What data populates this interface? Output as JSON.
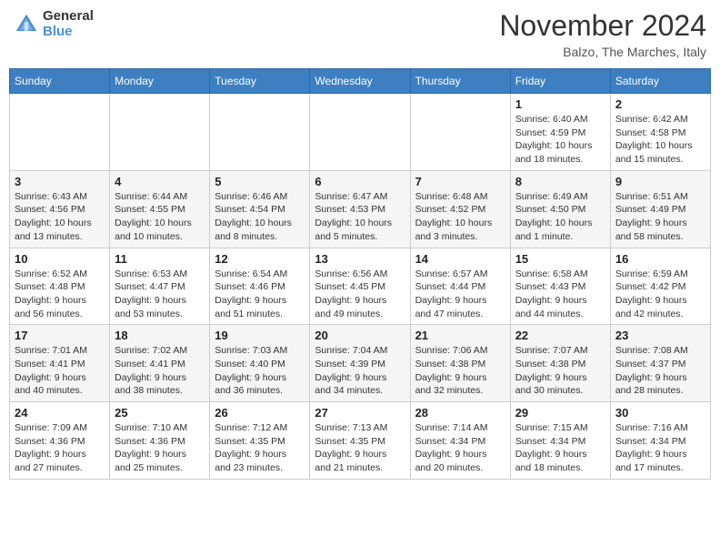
{
  "header": {
    "logo_general": "General",
    "logo_blue": "Blue",
    "month_title": "November 2024",
    "location": "Balzo, The Marches, Italy"
  },
  "weekdays": [
    "Sunday",
    "Monday",
    "Tuesday",
    "Wednesday",
    "Thursday",
    "Friday",
    "Saturday"
  ],
  "weeks": [
    [
      {
        "day": "",
        "info": ""
      },
      {
        "day": "",
        "info": ""
      },
      {
        "day": "",
        "info": ""
      },
      {
        "day": "",
        "info": ""
      },
      {
        "day": "",
        "info": ""
      },
      {
        "day": "1",
        "info": "Sunrise: 6:40 AM\nSunset: 4:59 PM\nDaylight: 10 hours\nand 18 minutes."
      },
      {
        "day": "2",
        "info": "Sunrise: 6:42 AM\nSunset: 4:58 PM\nDaylight: 10 hours\nand 15 minutes."
      }
    ],
    [
      {
        "day": "3",
        "info": "Sunrise: 6:43 AM\nSunset: 4:56 PM\nDaylight: 10 hours\nand 13 minutes."
      },
      {
        "day": "4",
        "info": "Sunrise: 6:44 AM\nSunset: 4:55 PM\nDaylight: 10 hours\nand 10 minutes."
      },
      {
        "day": "5",
        "info": "Sunrise: 6:46 AM\nSunset: 4:54 PM\nDaylight: 10 hours\nand 8 minutes."
      },
      {
        "day": "6",
        "info": "Sunrise: 6:47 AM\nSunset: 4:53 PM\nDaylight: 10 hours\nand 5 minutes."
      },
      {
        "day": "7",
        "info": "Sunrise: 6:48 AM\nSunset: 4:52 PM\nDaylight: 10 hours\nand 3 minutes."
      },
      {
        "day": "8",
        "info": "Sunrise: 6:49 AM\nSunset: 4:50 PM\nDaylight: 10 hours\nand 1 minute."
      },
      {
        "day": "9",
        "info": "Sunrise: 6:51 AM\nSunset: 4:49 PM\nDaylight: 9 hours\nand 58 minutes."
      }
    ],
    [
      {
        "day": "10",
        "info": "Sunrise: 6:52 AM\nSunset: 4:48 PM\nDaylight: 9 hours\nand 56 minutes."
      },
      {
        "day": "11",
        "info": "Sunrise: 6:53 AM\nSunset: 4:47 PM\nDaylight: 9 hours\nand 53 minutes."
      },
      {
        "day": "12",
        "info": "Sunrise: 6:54 AM\nSunset: 4:46 PM\nDaylight: 9 hours\nand 51 minutes."
      },
      {
        "day": "13",
        "info": "Sunrise: 6:56 AM\nSunset: 4:45 PM\nDaylight: 9 hours\nand 49 minutes."
      },
      {
        "day": "14",
        "info": "Sunrise: 6:57 AM\nSunset: 4:44 PM\nDaylight: 9 hours\nand 47 minutes."
      },
      {
        "day": "15",
        "info": "Sunrise: 6:58 AM\nSunset: 4:43 PM\nDaylight: 9 hours\nand 44 minutes."
      },
      {
        "day": "16",
        "info": "Sunrise: 6:59 AM\nSunset: 4:42 PM\nDaylight: 9 hours\nand 42 minutes."
      }
    ],
    [
      {
        "day": "17",
        "info": "Sunrise: 7:01 AM\nSunset: 4:41 PM\nDaylight: 9 hours\nand 40 minutes."
      },
      {
        "day": "18",
        "info": "Sunrise: 7:02 AM\nSunset: 4:41 PM\nDaylight: 9 hours\nand 38 minutes."
      },
      {
        "day": "19",
        "info": "Sunrise: 7:03 AM\nSunset: 4:40 PM\nDaylight: 9 hours\nand 36 minutes."
      },
      {
        "day": "20",
        "info": "Sunrise: 7:04 AM\nSunset: 4:39 PM\nDaylight: 9 hours\nand 34 minutes."
      },
      {
        "day": "21",
        "info": "Sunrise: 7:06 AM\nSunset: 4:38 PM\nDaylight: 9 hours\nand 32 minutes."
      },
      {
        "day": "22",
        "info": "Sunrise: 7:07 AM\nSunset: 4:38 PM\nDaylight: 9 hours\nand 30 minutes."
      },
      {
        "day": "23",
        "info": "Sunrise: 7:08 AM\nSunset: 4:37 PM\nDaylight: 9 hours\nand 28 minutes."
      }
    ],
    [
      {
        "day": "24",
        "info": "Sunrise: 7:09 AM\nSunset: 4:36 PM\nDaylight: 9 hours\nand 27 minutes."
      },
      {
        "day": "25",
        "info": "Sunrise: 7:10 AM\nSunset: 4:36 PM\nDaylight: 9 hours\nand 25 minutes."
      },
      {
        "day": "26",
        "info": "Sunrise: 7:12 AM\nSunset: 4:35 PM\nDaylight: 9 hours\nand 23 minutes."
      },
      {
        "day": "27",
        "info": "Sunrise: 7:13 AM\nSunset: 4:35 PM\nDaylight: 9 hours\nand 21 minutes."
      },
      {
        "day": "28",
        "info": "Sunrise: 7:14 AM\nSunset: 4:34 PM\nDaylight: 9 hours\nand 20 minutes."
      },
      {
        "day": "29",
        "info": "Sunrise: 7:15 AM\nSunset: 4:34 PM\nDaylight: 9 hours\nand 18 minutes."
      },
      {
        "day": "30",
        "info": "Sunrise: 7:16 AM\nSunset: 4:34 PM\nDaylight: 9 hours\nand 17 minutes."
      }
    ]
  ]
}
